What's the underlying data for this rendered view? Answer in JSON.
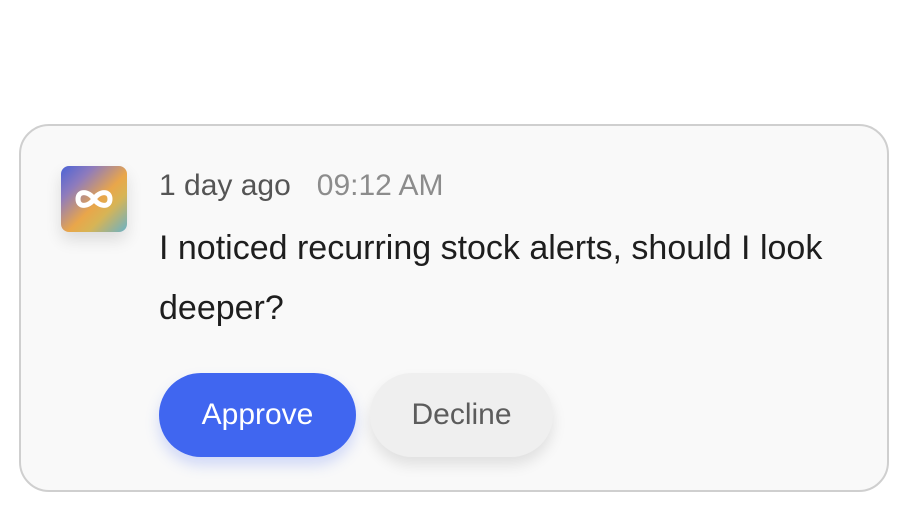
{
  "notification": {
    "app_icon": "infinity-icon",
    "relative_time": "1 day ago",
    "time": "09:12 AM",
    "message": "I noticed recurring stock alerts, should I look deeper?",
    "approve_label": "Approve",
    "decline_label": "Decline"
  },
  "colors": {
    "approve": "#4066f0",
    "decline_bg": "#efefef",
    "card_bg": "#f9f9f9"
  }
}
